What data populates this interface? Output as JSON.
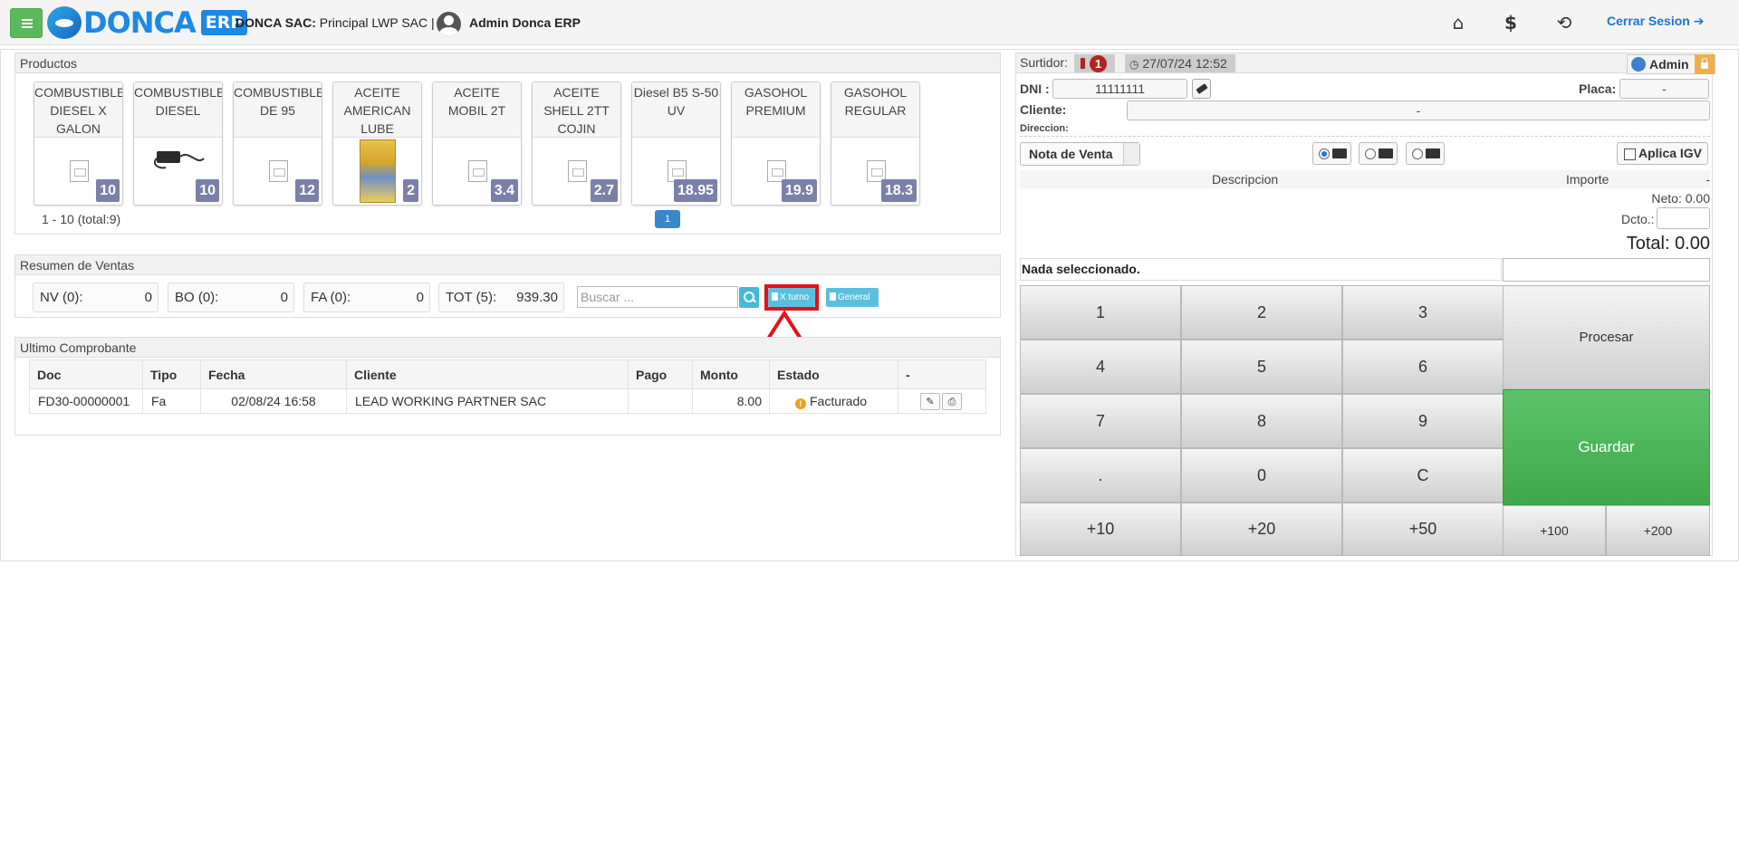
{
  "header": {
    "logo_text": "DONCA",
    "logo_badge": "ERP",
    "company_bold": "DONCA SAC:",
    "company_rest": " Principal LWP SAC |",
    "user": "Admin Donca ERP",
    "icons": [
      "home-icon",
      "dollar-icon",
      "lock-reset-icon"
    ],
    "logout_label": "Cerrar Sesion"
  },
  "productos": {
    "title": "Productos",
    "items": [
      {
        "name": "COMBUSTIBLE DIESEL X GALON",
        "price": "10",
        "image": "placeholder"
      },
      {
        "name": "COMBUSTIBLE DIESEL",
        "price": "10",
        "image": "charger"
      },
      {
        "name": "COMBUSTIBLE DE 95",
        "price": "12",
        "image": "placeholder"
      },
      {
        "name": "ACEITE AMERICAN LUBE",
        "price": "2",
        "image": "lube"
      },
      {
        "name": "ACEITE MOBIL 2T",
        "price": "3.4",
        "image": "placeholder"
      },
      {
        "name": "ACEITE SHELL 2TT COJIN",
        "price": "2.7",
        "image": "placeholder"
      },
      {
        "name": "Diesel B5 S-50 UV",
        "price": "18.95",
        "image": "placeholder"
      },
      {
        "name": "GASOHOL PREMIUM",
        "price": "19.9",
        "image": "placeholder"
      },
      {
        "name": "GASOHOL REGULAR",
        "price": "18.3",
        "image": "placeholder"
      }
    ],
    "pager_text": "1 - 10 (total:9)",
    "page": "1"
  },
  "resumen": {
    "title": "Resumen de Ventas",
    "boxes": [
      {
        "label": "NV (0):",
        "value": "0"
      },
      {
        "label": "BO (0):",
        "value": "0"
      },
      {
        "label": "FA (0):",
        "value": "0"
      },
      {
        "label": "TOT (5):",
        "value": "939.30"
      }
    ],
    "search_placeholder": "Buscar ...",
    "btn_turno": "X turno",
    "btn_general": "General"
  },
  "ultimo": {
    "title": "Ultimo Comprobante",
    "columns": [
      "Doc",
      "Tipo",
      "Fecha",
      "Cliente",
      "Pago",
      "Monto",
      "Estado",
      "-"
    ],
    "row": {
      "doc": "FD30-00000001",
      "tipo": "Fa",
      "fecha": "02/08/24 16:58",
      "cliente": "LEAD WORKING PARTNER SAC",
      "pago": "",
      "monto": "8.00",
      "estado": "Facturado"
    }
  },
  "venta": {
    "surtidor_label": "Surtidor:",
    "surtidor_count": "1",
    "datetime": "27/07/24 12:52",
    "admin": "Admin",
    "dni_label": "DNI :",
    "dni_value": "11111111",
    "placa_label": "Placa:",
    "placa_value": "-",
    "cliente_label": "Cliente:",
    "cliente_value": "-",
    "direccion_label": "Direccion:",
    "doc_type": "Nota de Venta",
    "igv_label": "Aplica IGV",
    "desc_col": "Descripcion",
    "importe_col": "Importe",
    "importe_dash": "-",
    "neto": "Neto: 0.00",
    "dcto_label": "Dcto.:",
    "total": "Total: 0.00",
    "nada": "Nada seleccionado.",
    "keys": [
      "1",
      "2",
      "3",
      "4",
      "5",
      "6",
      "7",
      "8",
      "9",
      ".",
      "0",
      "C",
      "+10",
      "+20",
      "+50",
      "+100",
      "+200"
    ],
    "procesar": "Procesar",
    "guardar": "Guardar"
  },
  "colors": {
    "accent_green": "#5cb85c",
    "brand_blue": "#1e88e5",
    "price_badge": "#7a80a8",
    "highlight_red": "#e0121f"
  }
}
